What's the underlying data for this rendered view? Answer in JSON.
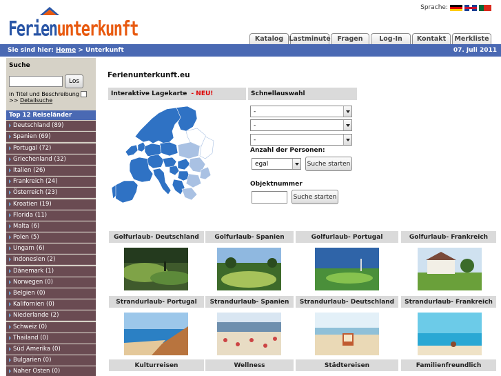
{
  "logo": {
    "text_a": "Ferien",
    "text_b": "unterkunft"
  },
  "language": {
    "label": "Sprache:"
  },
  "tabs": [
    "Katalog",
    "Lastminute",
    "Fragen",
    "Log-In",
    "Kontakt",
    "Merkliste"
  ],
  "breadcrumb": {
    "prefix": "Sie sind hier:",
    "home": "Home",
    "sep": ">",
    "current": "Unterkunft",
    "date": "07. Juli 2011"
  },
  "sidebar": {
    "search_title": "Suche",
    "search_button": "Los",
    "search_option": "in Titel und Beschreibung",
    "detail_prefix": ">>",
    "detail_link": "Detailsuche",
    "top_title": "Top 12 Reiseländer",
    "countries": [
      "Deutschland (89)",
      "Spanien (69)",
      "Portugal (72)",
      "Griechenland (32)",
      "Italien (26)",
      "Frankreich (24)",
      "Österreich (23)",
      "Kroatien (19)",
      "Florida (11)",
      "Malta (6)",
      "Polen (5)",
      "Ungarn (6)",
      "Indonesien (2)",
      "Dänemark (1)",
      "Norwegen (0)",
      "Belgien (0)",
      "Kalifornien (0)",
      "Niederlande (2)",
      "Schweiz (0)",
      "Thailand (0)",
      "Süd Amerika (0)",
      "Bulgarien (0)",
      "Naher Osten (0)"
    ]
  },
  "main": {
    "title": "Ferienunterkunft.eu",
    "map_title": "Interaktive Lagekarte",
    "map_new": "- NEU!",
    "quick_title": "Schnellauswahl",
    "selects": [
      "-",
      "-",
      "-"
    ],
    "persons_label": "Anzahl der Personen:",
    "persons_value": "egal",
    "search_start": "Suche starten",
    "object_label": "Objektnummer",
    "object_search": "Suche starten"
  },
  "categories_row1": [
    "Golfurlaub- Deutschland",
    "Golfurlaub- Spanien",
    "Golfurlaub- Portugal",
    "Golfurlaub- Frankreich"
  ],
  "categories_row2": [
    "Strandurlaub- Portugal",
    "Strandurlaub- Spanien",
    "Strandurlaub- Deutschland",
    "Strandurlaub- Frankreich"
  ],
  "categories_row3": [
    "Kulturreisen",
    "Wellness",
    "Städtereisen",
    "Familienfreundlich"
  ],
  "colors": {
    "nav_blue": "#4a69b3",
    "country_bg": "#6a4b52",
    "sidebar_bg": "#d6d2c7",
    "new_red": "#dd0000"
  }
}
